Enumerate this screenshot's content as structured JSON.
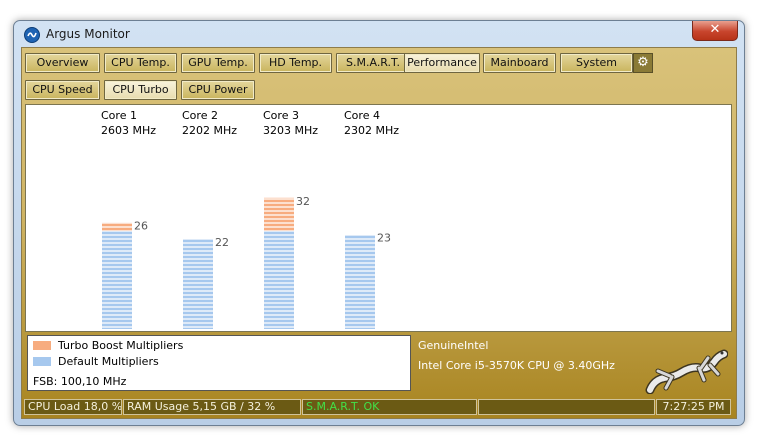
{
  "window": {
    "title": "Argus Monitor",
    "close_glyph": "✕"
  },
  "tabs": [
    {
      "label": "Overview"
    },
    {
      "label": "CPU Temp."
    },
    {
      "label": "GPU Temp."
    },
    {
      "label": "HD Temp."
    },
    {
      "label": "S.M.A.R.T."
    },
    {
      "label": "Performance",
      "active": true
    },
    {
      "label": "Mainboard"
    },
    {
      "label": "System"
    }
  ],
  "subtabs": [
    {
      "label": "CPU Speed"
    },
    {
      "label": "CPU Turbo",
      "active": true
    },
    {
      "label": "CPU Power"
    }
  ],
  "colors": {
    "turbo": "#f7ac7f",
    "default": "#a6c8ee",
    "panel_gold": "#cfb465",
    "status_ok": "#42e048"
  },
  "chart_data": {
    "type": "bar",
    "categories": [
      "Core 1",
      "Core 2",
      "Core 3",
      "Core 4"
    ],
    "freqs": [
      "2603 MHz",
      "2202 MHz",
      "3203 MHz",
      "2302 MHz"
    ],
    "series": [
      {
        "name": "Default Multipliers",
        "values": [
          24,
          22,
          24,
          23
        ]
      },
      {
        "name": "Turbo Boost Multipliers",
        "values": [
          2,
          0,
          8,
          0
        ]
      }
    ],
    "totals": [
      26,
      22,
      32,
      23
    ],
    "ylim": [
      0,
      48
    ]
  },
  "legend": {
    "turbo_label": "Turbo Boost Multipliers",
    "default_label": "Default Multipliers",
    "fsb": "FSB: 100,10 MHz"
  },
  "cpu": {
    "vendor": "GenuineIntel",
    "model": "Intel Core i5-3570K CPU @ 3.40GHz"
  },
  "status": {
    "cpu_load": "CPU Load 18,0 %",
    "ram": "RAM Usage 5,15 GB / 32 %",
    "smart": "S.M.A.R.T. OK",
    "time": "7:27:25 PM"
  },
  "icons": {
    "gear": "gear-icon",
    "app": "argus-logo-icon",
    "gecko": "gecko-logo"
  }
}
